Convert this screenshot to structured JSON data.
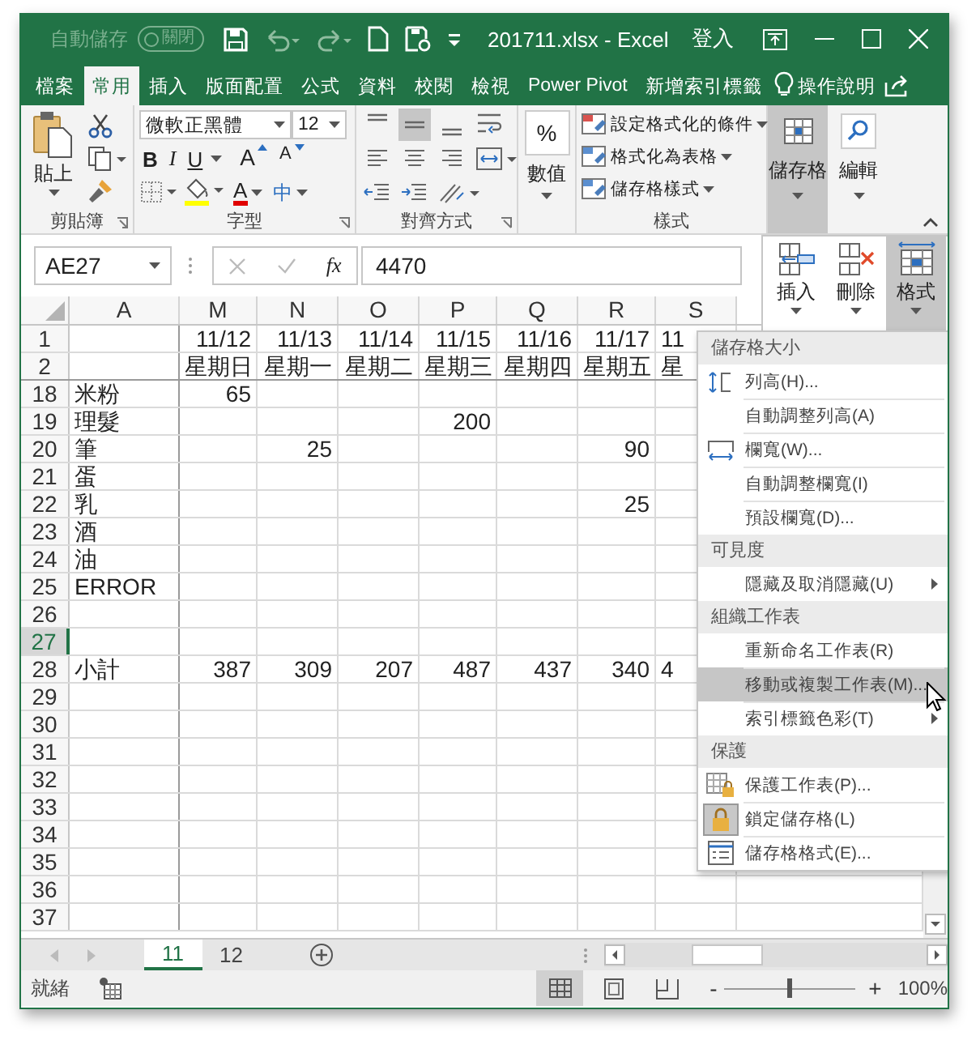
{
  "title_bar": {
    "autosave_label": "自動儲存",
    "autosave_toggle": "關閉",
    "autosave_on": false,
    "title": "201711.xlsx - Excel",
    "sign_in": "登入"
  },
  "ribbon_tabs": [
    {
      "label": "檔案",
      "selected": false
    },
    {
      "label": "常用",
      "selected": true
    },
    {
      "label": "插入",
      "selected": false
    },
    {
      "label": "版面配置",
      "selected": false
    },
    {
      "label": "公式",
      "selected": false
    },
    {
      "label": "資料",
      "selected": false
    },
    {
      "label": "校閱",
      "selected": false
    },
    {
      "label": "檢視",
      "selected": false
    },
    {
      "label": "Power Pivot",
      "selected": false
    },
    {
      "label": "新增索引標籤",
      "selected": false
    }
  ],
  "tell_me": "操作說明",
  "ribbon": {
    "clipboard": {
      "paste": "貼上",
      "label": "剪貼簿"
    },
    "font": {
      "font_name": "微軟正黑體",
      "font_size": "12",
      "bold": "B",
      "italic": "I",
      "underline": "U",
      "grow": "A",
      "shrink": "A",
      "font_color": "A",
      "phonetic": "中",
      "label": "字型"
    },
    "alignment": {
      "vertical": [
        {
          "kind": "top",
          "selected": false
        },
        {
          "kind": "middle",
          "selected": true
        },
        {
          "kind": "bottom",
          "selected": false
        }
      ],
      "label": "對齊方式"
    },
    "number": {
      "symbol": "%",
      "button": "數值"
    },
    "styles": {
      "items": [
        "設定格式化的條件",
        "格式化為表格",
        "儲存格樣式"
      ],
      "label": "樣式"
    },
    "cells": {
      "button": "儲存格",
      "open": true
    },
    "editing": {
      "button": "編輯"
    }
  },
  "cells_panel": [
    {
      "label": "插入",
      "selected": false
    },
    {
      "label": "刪除",
      "selected": false
    },
    {
      "label": "格式",
      "selected": true
    }
  ],
  "formula_bar": {
    "name_box": "AE27",
    "fx": "fx",
    "value": "4470"
  },
  "sheet": {
    "columns": [
      "A",
      "M",
      "N",
      "O",
      "P",
      "Q",
      "R",
      "S"
    ],
    "rows": [
      {
        "header": "1",
        "selected": false,
        "cells": [
          "",
          "11/12",
          "11/13",
          "11/14",
          "11/15",
          "11/16",
          "11/17",
          "11"
        ]
      },
      {
        "header": "2",
        "selected": false,
        "cells": [
          "",
          "星期日",
          "星期一",
          "星期二",
          "星期三",
          "星期四",
          "星期五",
          "星"
        ]
      },
      {
        "header": "18",
        "selected": false,
        "cells": [
          "米粉",
          "65"
        ]
      },
      {
        "header": "19",
        "selected": false,
        "cells": [
          "理髮",
          "",
          "",
          "",
          "200"
        ]
      },
      {
        "header": "20",
        "selected": false,
        "cells": [
          "筆",
          "",
          "25",
          "",
          "",
          "",
          "90"
        ]
      },
      {
        "header": "21",
        "selected": false,
        "cells": [
          "蛋"
        ]
      },
      {
        "header": "22",
        "selected": false,
        "cells": [
          "乳",
          "",
          "",
          "",
          "",
          "",
          "25"
        ]
      },
      {
        "header": "23",
        "selected": false,
        "cells": [
          "酒"
        ]
      },
      {
        "header": "24",
        "selected": false,
        "cells": [
          "油"
        ]
      },
      {
        "header": "25",
        "selected": false,
        "cells": [
          "ERROR"
        ]
      },
      {
        "header": "26",
        "selected": false
      },
      {
        "header": "27",
        "selected": true
      },
      {
        "header": "28",
        "selected": false,
        "cells": [
          "小計",
          "387",
          "309",
          "207",
          "487",
          "437",
          "340",
          "4"
        ]
      },
      {
        "header": "29",
        "selected": false
      },
      {
        "header": "30",
        "selected": false
      },
      {
        "header": "31",
        "selected": false
      },
      {
        "header": "32",
        "selected": false
      },
      {
        "header": "33",
        "selected": false
      },
      {
        "header": "34",
        "selected": false
      },
      {
        "header": "35",
        "selected": false
      },
      {
        "header": "36",
        "selected": false
      },
      {
        "header": "37",
        "selected": false
      }
    ]
  },
  "format_menu": {
    "sections": [
      {
        "title": "儲存格大小",
        "items": [
          {
            "label": "列高(H)...",
            "kind": "row-height",
            "hovered": false
          },
          {
            "label": "自動調整列高(A)",
            "kind": "plain",
            "hovered": false
          },
          {
            "label": "欄寬(W)...",
            "kind": "column-width",
            "hovered": false
          },
          {
            "label": "自動調整欄寬(I)",
            "kind": "plain",
            "hovered": false
          },
          {
            "label": "預設欄寬(D)...",
            "kind": "plain",
            "hovered": false
          }
        ]
      },
      {
        "title": "可見度",
        "items": [
          {
            "label": "隱藏及取消隱藏(U)",
            "kind": "submenu",
            "hovered": false
          }
        ]
      },
      {
        "title": "組織工作表",
        "items": [
          {
            "label": "重新命名工作表(R)",
            "kind": "plain",
            "hovered": false
          },
          {
            "label": "移動或複製工作表(M)...",
            "kind": "plain",
            "hovered": true
          },
          {
            "label": "索引標籤色彩(T)",
            "kind": "submenu",
            "hovered": false
          }
        ]
      },
      {
        "title": "保護",
        "items": [
          {
            "label": "保護工作表(P)...",
            "kind": "protect-sheet",
            "hovered": false,
            "checked": false
          },
          {
            "label": "鎖定儲存格(L)",
            "kind": "lock",
            "hovered": false,
            "checked": true
          },
          {
            "label": "儲存格格式(E)...",
            "kind": "cell-format",
            "hovered": false,
            "checked": false
          }
        ]
      }
    ]
  },
  "sheet_tabs": [
    {
      "label": "11",
      "selected": true
    },
    {
      "label": "12",
      "selected": false
    }
  ],
  "status_bar": {
    "status": "就緒",
    "views": [
      {
        "kind": "normal",
        "selected": true
      },
      {
        "kind": "page-layout",
        "selected": false
      },
      {
        "kind": "page-break",
        "selected": false
      }
    ],
    "zoom_out": "-",
    "zoom_in": "+",
    "zoom": {
      "level": 0.5,
      "reading": "100%"
    }
  }
}
